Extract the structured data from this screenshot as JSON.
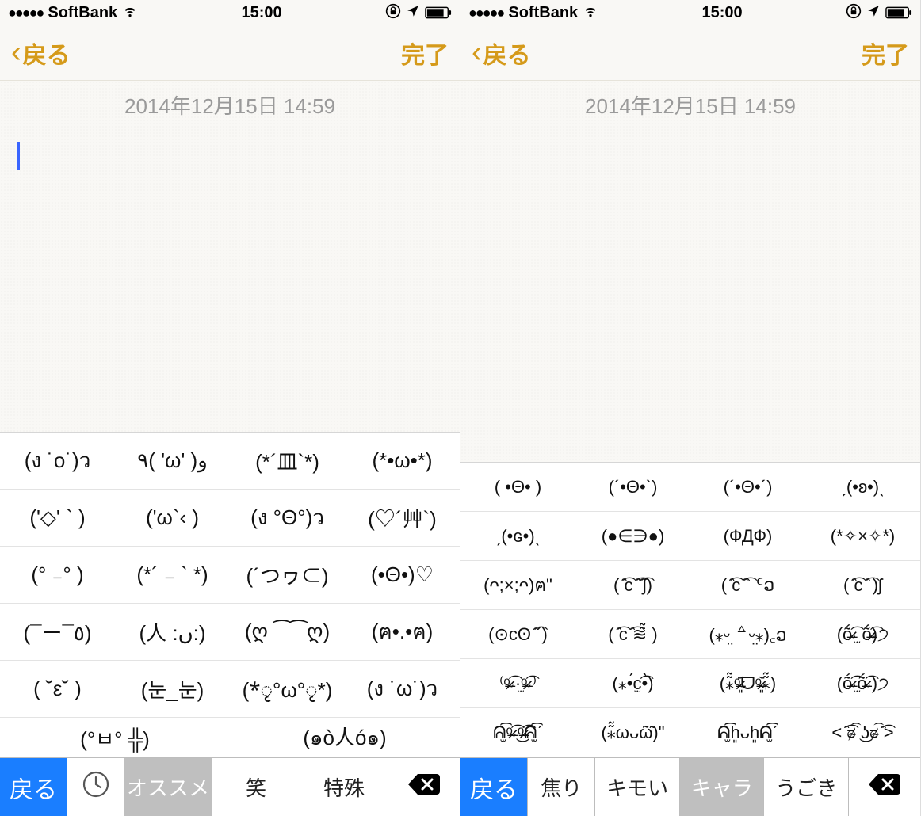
{
  "left": {
    "status": {
      "carrier": "SoftBank",
      "time": "15:00",
      "dots": "●●●●●"
    },
    "nav": {
      "back": "戻る",
      "done": "完了"
    },
    "note": {
      "date": "2014年12月15日 14:59"
    },
    "grid": {
      "r0": {
        "c0": "(ง ˙ο˙)ว",
        "c1": "٩( 'ω' )و",
        "c2": "(*´皿`*)",
        "c3": "(*•ω•*)"
      },
      "r1": {
        "c0": "('◇' ` )",
        "c1": "('ω`‹ )",
        "c2": "(ง °Θ°)ว",
        "c3": "(♡´艸`)"
      },
      "r2": {
        "c0": "(° ₋° )",
        "c1": "(*´ ₋ ` *)",
        "c2": "(´つヮ⊂)",
        "c3": "(•Θ•)♡"
      },
      "r3": {
        "c0": "(¯ー¯٥)",
        "c1": "(人 :ں:)",
        "c2": "(ღ ⁀⁀ღ)",
        "c3": "(ฅ•.•ฅ)"
      },
      "r4": {
        "c0": "( ˘ε˘ )",
        "c1": "(눈_눈)",
        "c2": "(*ृ°ω°ृ*)",
        "c3": "(ง ˙ω˙)ว"
      },
      "r5": {
        "c0": "(°ㅂ° ╬)",
        "c1": "(๑ò人ó๑)"
      }
    },
    "tabs": {
      "back": "戻る",
      "cat1": "オススメ",
      "cat2": "笑",
      "cat3": "特殊"
    }
  },
  "right": {
    "status": {
      "carrier": "SoftBank",
      "time": "15:00",
      "dots": "●●●●●"
    },
    "nav": {
      "back": "戻る",
      "done": "完了"
    },
    "note": {
      "date": "2014年12月15日 14:59"
    },
    "grid": {
      "r0": {
        "c0": "( •Θ• )",
        "c1": "(´•Θ•`)",
        "c2": "(´•Θ•´)",
        "c3": "ˏ(•ʚ•)ˎ"
      },
      "r1": {
        "c0": "ˏ(•ԍ•)ˎ",
        "c1": "(●∈∋●)",
        "c2": "(ФДФ)",
        "c3": "(*✧×✧*)"
      },
      "r4": {
        "c0": "⁽ᵒ̴̶̷͡ ·̫ᵒ̴̶̷͡ ⁾",
        "c1": "(⁎•́c̫͡•̀)",
        "c2": "(⁎͂͂ᵒ̴̶̷͈᷄ᗜᵒ̴̶̷͈᷅⁎͂͂)",
        "c3": "(ṍ̴̶̷͡ ̫ṍ̴̶̷͡ )੭"
      }
    },
    "tabs": {
      "back": "戻る",
      "cat1": "焦り",
      "cat2": "キモい",
      "cat3": "キャラ",
      "cat4": "うごき"
    }
  }
}
